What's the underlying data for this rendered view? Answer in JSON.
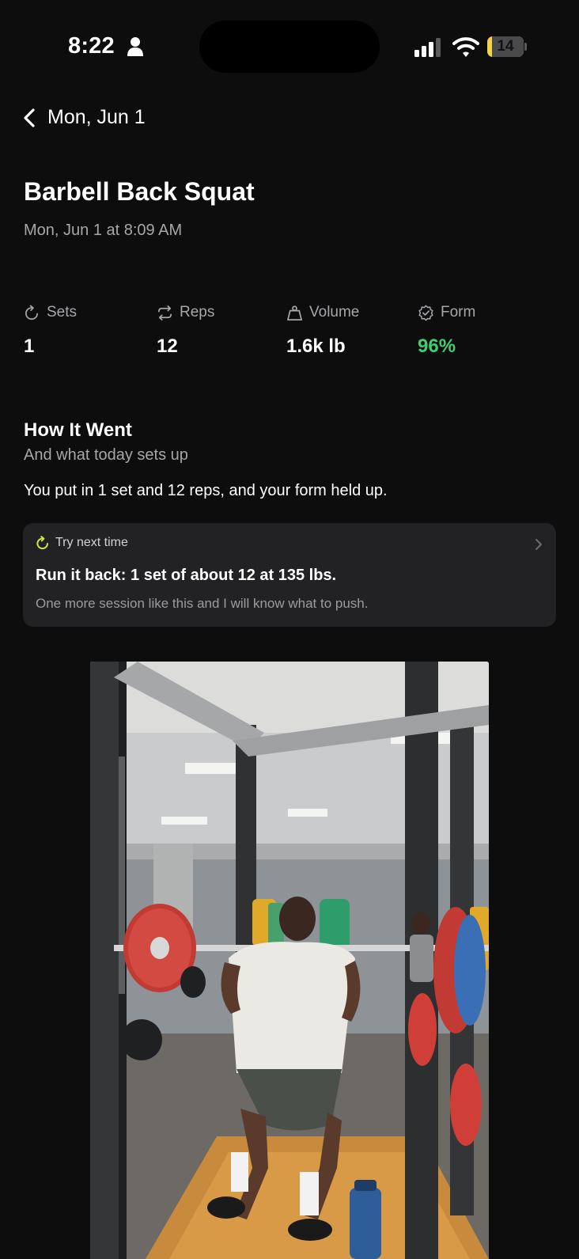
{
  "status_bar": {
    "time": "8:22",
    "battery": "14",
    "battery_level": 0.14
  },
  "nav": {
    "back_label": "Mon, Jun 1"
  },
  "exercise": {
    "title": "Barbell Back Squat",
    "datetime": "Mon, Jun 1 at 8:09 AM"
  },
  "stats": [
    {
      "label": "Sets",
      "value": "1",
      "icon": "refresh-icon"
    },
    {
      "label": "Reps",
      "value": "12",
      "icon": "repeat-icon"
    },
    {
      "label": "Volume",
      "value": "1.6k lb",
      "icon": "weight-icon"
    },
    {
      "label": "Form",
      "value": "96%",
      "icon": "check-badge-icon"
    }
  ],
  "summary": {
    "title": "How It Went",
    "subtitle": "And what today sets up",
    "body": "You put in 1 set and 12 reps, and your form held up."
  },
  "next_card": {
    "tag": "Try next time",
    "headline": "Run it back: 1 set of about 12 at 135 lbs.",
    "note": "One more session like this and I will know what to push."
  },
  "colors": {
    "background": "#0d0d0e",
    "card": "#222224",
    "accent_green": "#3ecf6e",
    "accent_lime": "#c8e84a",
    "muted_text": "#a7a7ab",
    "battery": "#f6d44a"
  }
}
